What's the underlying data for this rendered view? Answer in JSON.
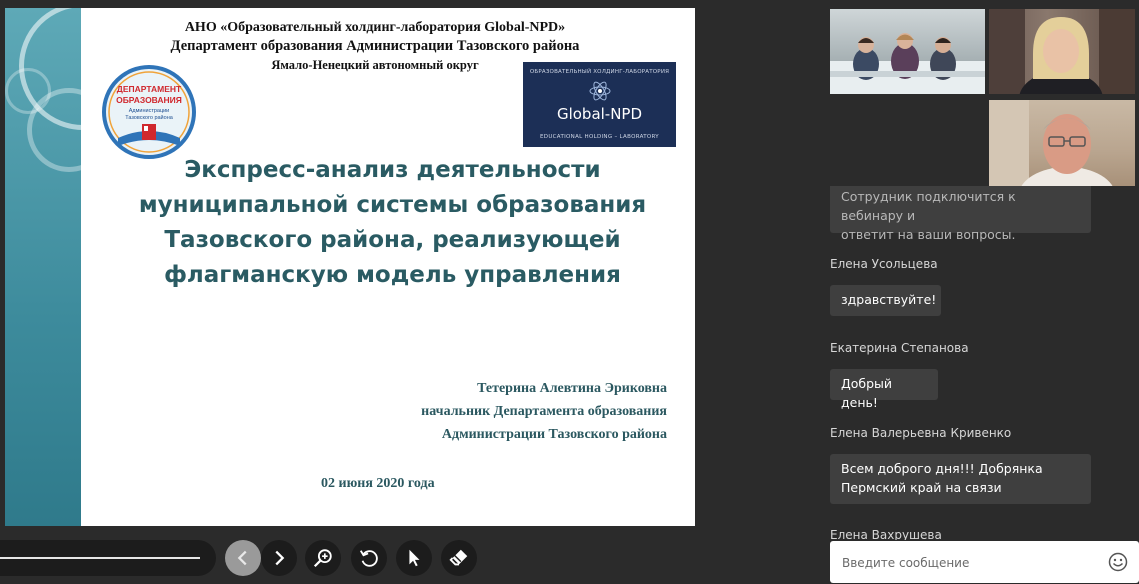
{
  "slide": {
    "header": {
      "line1": "АНО «Образовательный холдинг-лаборатория  Global-NPD»",
      "line2": "Департамент образования Администрации Тазовского района",
      "line3": "Ямало-Ненецкий автономный округ"
    },
    "dept_logo": {
      "line1": "ДЕПАРТАМЕНТ",
      "line2": "ОБРАЗОВАНИЯ",
      "line3": "Администрации",
      "line4": "Тазовского района"
    },
    "gnpd_logo": {
      "top": "ОБРАЗОВАТЕЛЬНЫЙ ХОЛДИНГ-ЛАБОРАТОРИЯ",
      "name": "Global-NPD",
      "bottom": "EDUCATIONAL HOLDING – LABORATORY"
    },
    "title_lines": [
      "Экспресс-анализ деятельности",
      "муниципальной системы образования",
      "Тазовского района, реализующей",
      "флагманскую модель управления"
    ],
    "author": {
      "name": "Тетерина Алевтина Эриковна",
      "position": "начальник Департамента образования",
      "organization": "Администрации Тазовского района"
    },
    "date": "02 июня 2020 года"
  },
  "toolbar": {
    "icons": [
      "chevron-left-icon",
      "chevron-right-icon",
      "zoom-in-icon",
      "rotate-icon",
      "pointer-icon",
      "eraser-icon"
    ]
  },
  "chat": {
    "partial_message": {
      "line1": "Сотрудник подключится к вебинару и",
      "line2": "ответит на ваши вопросы."
    },
    "messages": [
      {
        "author": "Елена Усольцева",
        "lines": [
          "здравствуйте!"
        ]
      },
      {
        "author": "Екатерина Степанова",
        "lines": [
          "Добрый день!"
        ]
      },
      {
        "author": "Елена Валерьевна Кривенко",
        "lines": [
          "Всем доброго дня!!!  Добрянка",
          "Пермский край на связи"
        ]
      },
      {
        "author": "Елена Вахрушева",
        "lines": []
      }
    ],
    "input": {
      "placeholder": "Введите сообщение",
      "value": ""
    }
  },
  "colors": {
    "background": "#2b2b2b",
    "title": "#2a5b63",
    "slide_band": "#3d8b9c",
    "bubble": "#3f3f3f"
  }
}
